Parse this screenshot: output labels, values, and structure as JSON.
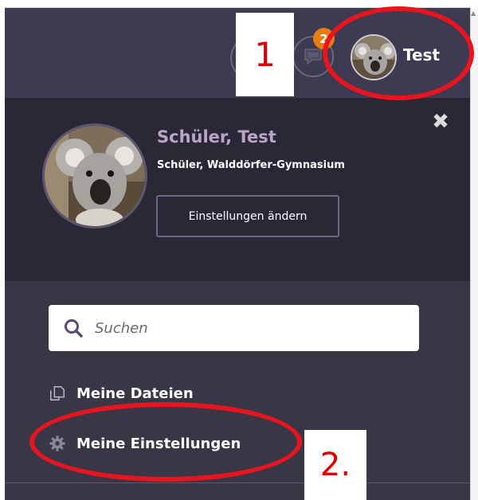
{
  "header": {
    "chat_badge_count": "2",
    "user_short_name": "Test"
  },
  "annotations": {
    "step1_label": "1",
    "step2_label": "2."
  },
  "profile": {
    "name": "Schüler, Test",
    "subtitle": "Schüler, Walddörfer-Gymnasium",
    "edit_button_label": "Einstellungen ändern"
  },
  "search": {
    "placeholder": "Suchen"
  },
  "menu": {
    "files_label": "Meine Dateien",
    "settings_label": "Meine Einstellungen"
  },
  "colors": {
    "header_bg": "#3d3a52",
    "panel_dark": "#2b2836",
    "panel_mid": "#3a3646",
    "accent_name": "#b8a5c8",
    "badge": "#e57d12",
    "annotation_red": "#e8141e"
  },
  "icons": {
    "close": "close-icon",
    "search": "search-icon",
    "files": "files-icon",
    "settings": "gear-icon",
    "chat": "chat-icon"
  }
}
